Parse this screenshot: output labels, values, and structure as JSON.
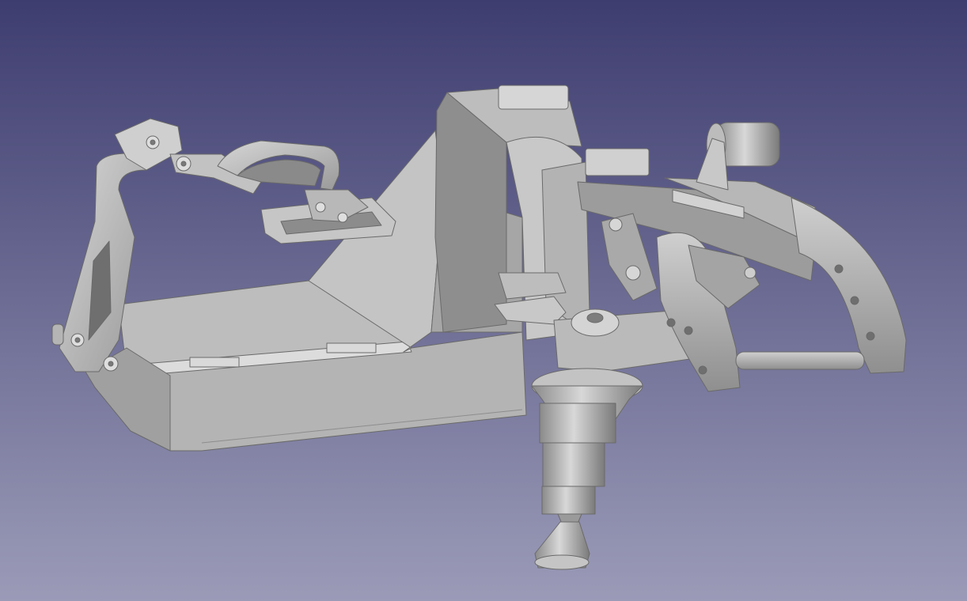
{
  "viewport": {
    "background_top": "#3e3d70",
    "background_bottom": "#9b9bb8",
    "part_light": "#c9c9c9",
    "part_mid": "#a9a9a9",
    "part_dark": "#7d7d7d",
    "part_darker": "#5f5f5f",
    "model_label": "",
    "navigation_cursor": "none"
  }
}
